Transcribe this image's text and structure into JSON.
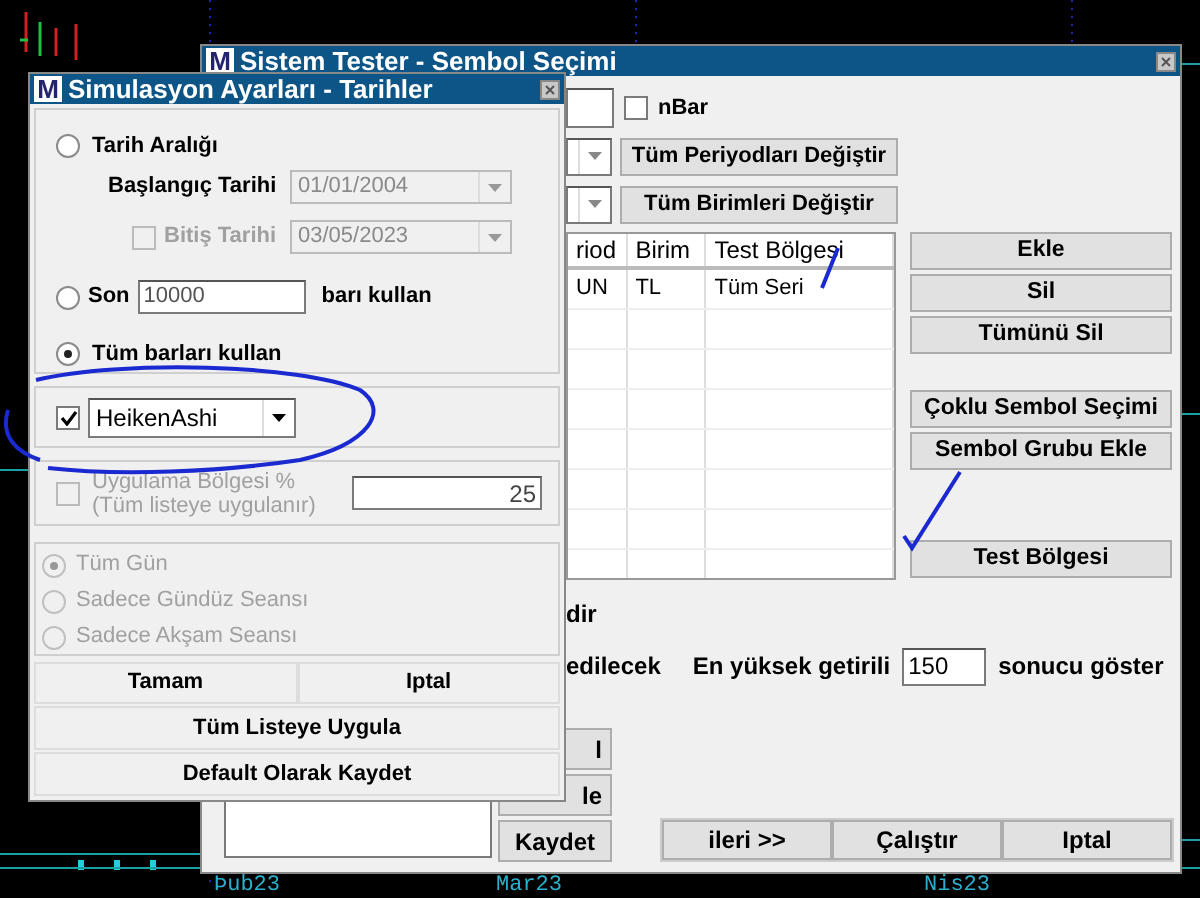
{
  "chart": {
    "axis_labels": [
      "Þub23",
      "Mar23",
      "Nis23"
    ]
  },
  "back_window": {
    "icon": "M",
    "title": "Sistem Tester - Sembol Seçimi",
    "nbar": {
      "label": "nBar",
      "checked": false
    },
    "change_buttons": [
      "Tüm Periyodları Değiştir",
      "Tüm Birimleri Değiştir"
    ],
    "table": {
      "columns": [
        "riod",
        "Birim",
        "Test Bölgesi"
      ],
      "rows": [
        [
          "UN",
          "TL",
          "Tüm Seri"
        ]
      ]
    },
    "side_buttons": [
      "Ekle",
      "Sil",
      "Tümünü Sil",
      "Çoklu Sembol Seçimi",
      "Sembol Grubu Ekle",
      "Test Bölgesi"
    ],
    "text_1": "dir",
    "text_2": "edilecek",
    "top_results": {
      "label": "En yüksek getirili",
      "value": "150",
      "suffix": "sonucu göster"
    },
    "left_buttons": [
      "l",
      "le",
      "Kaydet"
    ],
    "footer_buttons": [
      "ileri >>",
      "Çalıştır",
      "Iptal"
    ]
  },
  "dialog": {
    "icon": "M",
    "title": "Simulasyon Ayarları - Tarihler",
    "date_range": {
      "label": "Tarih Aralığı",
      "selected": false,
      "start": {
        "label": "Başlangıç Tarihi",
        "value": "01/01/2004",
        "disabled": true
      },
      "end": {
        "label": "Bitiş Tarihi",
        "checked": false,
        "value": "03/05/2023",
        "disabled": true
      }
    },
    "last_n": {
      "label": "Son",
      "value": "10000",
      "suffix": "barı kullan",
      "selected": false
    },
    "all_bars": {
      "label": "Tüm barları kullan",
      "selected": true
    },
    "bar_type": {
      "checked": true,
      "value": "HeikenAshi"
    },
    "apply_region": {
      "label": "Uygulama Bölgesi %",
      "note": "(Tüm listeye uygulanır)",
      "checked": false,
      "disabled": true,
      "value": "25"
    },
    "sessions": [
      {
        "label": "Tüm Gün",
        "selected": true,
        "disabled": true
      },
      {
        "label": "Sadece Gündüz Seansı",
        "selected": false,
        "disabled": true
      },
      {
        "label": "Sadece Akşam Seansı",
        "selected": false,
        "disabled": true
      }
    ],
    "buttons": [
      "Tamam",
      "Iptal"
    ],
    "wide_buttons": [
      "Tüm Listeye Uygula",
      "Default Olarak Kaydet"
    ]
  }
}
